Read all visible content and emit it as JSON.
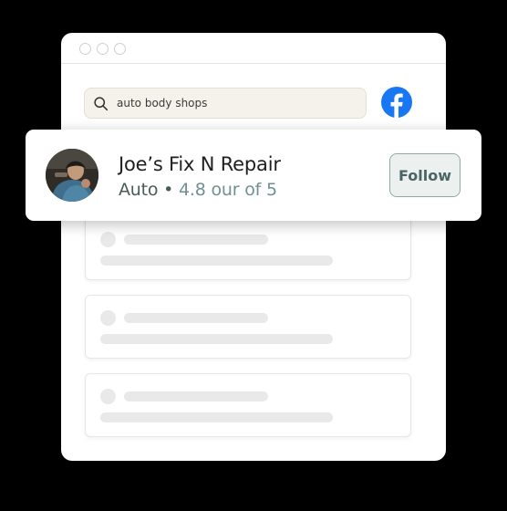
{
  "search": {
    "query": "auto body shops"
  },
  "social": {
    "icon": "facebook-icon",
    "brand_color": "#1877F2"
  },
  "profile": {
    "name": "Joe’s Fix N Repair",
    "category": "Auto",
    "separator": " • ",
    "rating_text": "4.8 our of 5",
    "follow_label": "Follow"
  },
  "colors": {
    "background": "#000000",
    "rating_text": "#6f9191",
    "follow_border": "#8eaaa7"
  }
}
